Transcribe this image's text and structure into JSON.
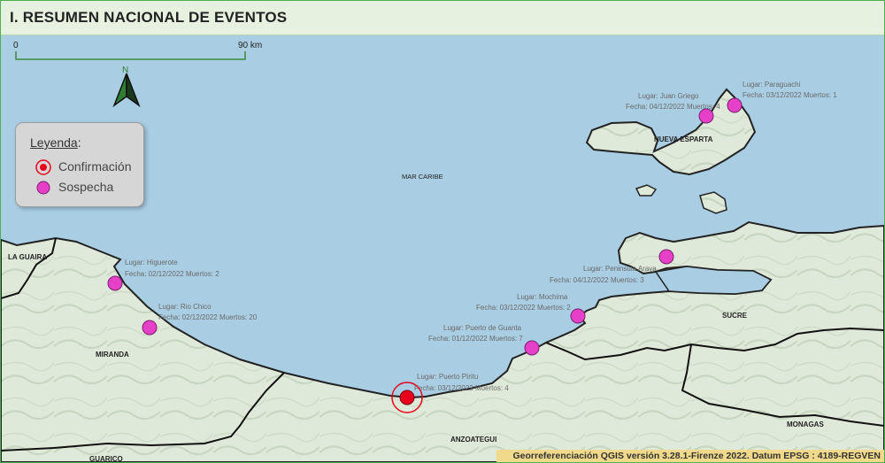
{
  "header": {
    "title": "I. RESUMEN NACIONAL DE EVENTOS"
  },
  "scale": {
    "start_label": "0",
    "end_label": "90 km"
  },
  "north_arrow": {
    "label": "N",
    "icon": "north-arrow-icon"
  },
  "legend": {
    "title": "Leyenda",
    "title_suffix": ":",
    "items": [
      {
        "label": "Confirmación",
        "color": "#e8001c",
        "icon": "confirmed-marker-icon"
      },
      {
        "label": "Sospecha",
        "color": "#e640c8",
        "icon": "suspected-marker-icon"
      }
    ]
  },
  "sea_label": "MAR CARIBE",
  "regions": [
    "LA GUAIRA",
    "MIRANDA",
    "GUARICO",
    "ANZOATEGUI",
    "SUCRE",
    "MONAGAS",
    "NUEVA ESPARTA"
  ],
  "events": [
    {
      "lugar": "Lugar: Paraguachi",
      "detalle": "Fecha: 03/12/2022 Muertos: 1",
      "type": "sospecha"
    },
    {
      "lugar": "Lugar: Juan Griego",
      "detalle": "Fecha: 04/12/2022 Muertos: 4",
      "type": "sospecha"
    },
    {
      "lugar": "Lugar: Higuerote",
      "detalle": "Fecha: 02/12/2022 Muertos: 2",
      "type": "sospecha"
    },
    {
      "lugar": "Lugar: Rio Chico",
      "detalle": "Fecha: 02/12/2022 Muertos: 20",
      "type": "sospecha"
    },
    {
      "lugar": "Lugar: Peninsula Araya",
      "detalle": "Fecha: 04/12/2022 Muertos: 3",
      "type": "sospecha"
    },
    {
      "lugar": "Lugar: Mochima",
      "detalle": "Fecha: 03/12/2022 Muertos: 2",
      "type": "sospecha"
    },
    {
      "lugar": "Lugar: Puerto de Guanta",
      "detalle": "Fecha: 01/12/2022 Muertos: 7",
      "type": "sospecha"
    },
    {
      "lugar": "Lugar: Puerto Píritu",
      "detalle": "Fecha: 03/12/2022 Muertos: 4",
      "type": "confirmacion"
    }
  ],
  "colors": {
    "sea": "#a9cde3",
    "land": "#dfe9d9",
    "suspect": "#e640c8",
    "confirm": "#e8001c"
  },
  "footer": {
    "text": "Georreferenciación QGIS versión 3.28.1-Firenze 2022. Datum EPSG : 4189-REGVEN"
  }
}
